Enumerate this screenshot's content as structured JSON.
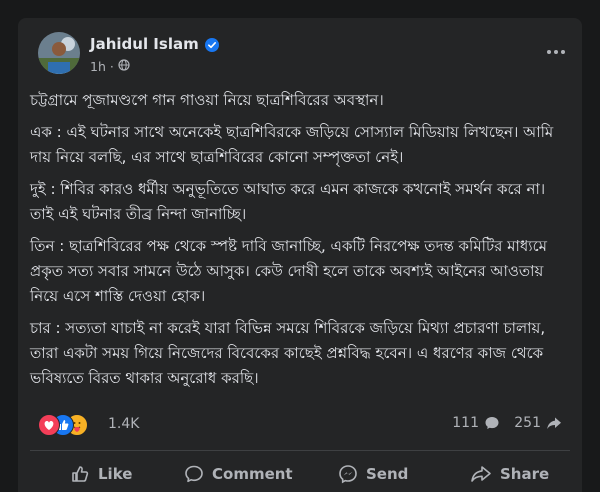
{
  "post": {
    "author": "Jahidul Islam",
    "time": "1h",
    "verified_icon": "verified-badge-icon",
    "privacy_icon": "globe-icon",
    "paragraphs": [
      "চট্টগ্রামে পূজামণ্ডপে গান গাওয়া নিয়ে ছাত্রশিবিরের অবস্থান।",
      "এক : এই ঘটনার সাথে অনেকেই ছাত্রশিবিরকে জড়িয়ে সোস্যাল মিডিয়ায় লিখছেন। আমি দায় নিয়ে বলছি, এর সাথে ছাত্রশিবিরের কোনো সম্পৃক্ততা নেই।",
      "দুই : শিবির কারও ধর্মীয় অনুভূতিতে আঘাত করে এমন কাজকে কখনোই সমর্থন করে না। তাই এই ঘটনার তীব্র নিন্দা জানাচ্ছি।",
      "তিন : ছাত্রশিবিরের পক্ষ থেকে স্পষ্ট দাবি জানাচ্ছি, একটি নিরপেক্ষ তদন্ত কমিটির মাধ্যমে প্রকৃত সত্য সবার সামনে উঠে আসুক। কেউ দোষী হলে তাকে অবশ্যই আইনের আওতায় নিয়ে এসে শাস্তি দেওয়া হোক।",
      "চার : সত্যতা যাচাই না করেই যারা বিভিন্ন সময়ে শিবিরকে জড়িয়ে মিথ্যা প্রচারণা চালায়, তারা একটা সময় গিয়ে নিজেদের বিবেকের কাছেই প্রশ্নবিদ্ধ হবেন। এ ধরণের কাজ থেকে ভবিষ্যতে বিরত থাকার অনুরোধ করছি।"
    ]
  },
  "reactions": {
    "icons": [
      "love-icon",
      "like-icon",
      "care-icon"
    ],
    "count": "1.4K",
    "comments": "111",
    "shares": "251"
  },
  "actions": {
    "like": "Like",
    "comment": "Comment",
    "send": "Send",
    "share": "Share"
  },
  "colors": {
    "page_bg": "#18191a",
    "card_bg": "#242526",
    "text": "#e4e6eb",
    "secondary_text": "#b0b3b8",
    "verified": "#1877f2",
    "like": "#1877f2",
    "love": "#f33e58",
    "care": "#f7b125"
  }
}
